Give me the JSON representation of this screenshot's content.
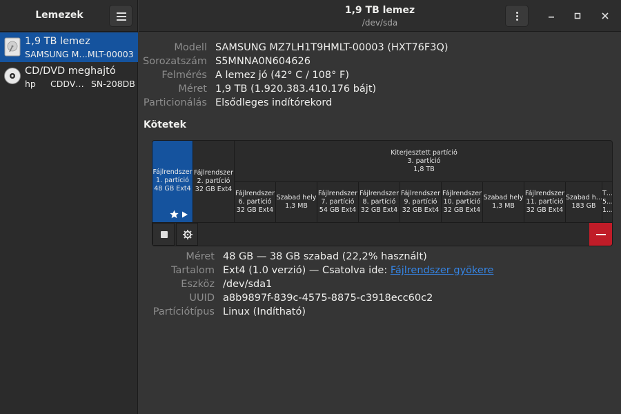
{
  "sidebar": {
    "title": "Lemezek",
    "menu_icon": "hamburger-menu-icon",
    "devices": [
      {
        "name": "1,9 TB lemez",
        "sub": "SAMSUNG M…MLT-00003",
        "icon": "disk-drive-icon",
        "selected": true
      },
      {
        "name": "CD/DVD meghajtó",
        "sub_a": "hp",
        "sub_b": "CDDV…",
        "sub_c": "SN-208DB",
        "icon": "optical-disc-icon",
        "selected": false
      }
    ]
  },
  "header": {
    "title": "1,9 TB lemez",
    "subtitle": "/dev/sda",
    "menu_icon": "kebab-menu-icon",
    "window_controls": [
      "minimize-icon",
      "maximize-icon",
      "close-icon"
    ]
  },
  "drive": {
    "rows": [
      {
        "key": "Modell",
        "value": "SAMSUNG MZ7LH1T9HMLT-00003 (HXT76F3Q)"
      },
      {
        "key": "Sorozatszám",
        "value": "S5MNNA0N604626"
      },
      {
        "key": "Felmérés",
        "value": "A lemez jó (42° C / 108° F)"
      },
      {
        "key": "Méret",
        "value": "1,9 TB (1.920.383.410.176 bájt)"
      },
      {
        "key": "Particionálás",
        "value": "Elsődleges indítórekord"
      }
    ]
  },
  "volumes": {
    "title": "Kötetek",
    "extended": {
      "l1": "Kiterjesztett partíció",
      "l2": "3. partíció",
      "l3": "1,8 TB"
    },
    "blocks": [
      {
        "l1": "Fájlrendszer",
        "l2": "1. partíció",
        "l3": "48 GB Ext4",
        "selected": true
      },
      {
        "l1": "Fájlrendszer",
        "l2": "2. partíció",
        "l3": "32 GB Ext4"
      },
      {
        "l1": "Fájlrendszer",
        "l2": "6. partíció",
        "l3": "32 GB Ext4"
      },
      {
        "l1": "Szabad hely",
        "l2": "1,3 MB",
        "l3": ""
      },
      {
        "l1": "Fájlrendszer",
        "l2": "7. partíció",
        "l3": "54 GB Ext4"
      },
      {
        "l1": "Fájlrendszer",
        "l2": "8. partíció",
        "l3": "32 GB Ext4"
      },
      {
        "l1": "Fájlrendszer",
        "l2": "9. partíció",
        "l3": "32 GB Ext4"
      },
      {
        "l1": "Fájlrendszer",
        "l2": "10. partíció",
        "l3": "32 GB Ext4"
      },
      {
        "l1": "Szabad hely",
        "l2": "1,3 MB",
        "l3": ""
      },
      {
        "l1": "Fájlrendszer",
        "l2": "11. partíció",
        "l3": "32 GB Ext4"
      },
      {
        "l1": "Szabad h…",
        "l2": "183 GB",
        "l3": ""
      },
      {
        "l1": "T…",
        "l2": "5…",
        "l3": "1…"
      }
    ],
    "toolbar_icons": [
      "stop-icon",
      "gear-icon",
      "minus-icon"
    ],
    "selected_badges": [
      "star-icon",
      "play-icon"
    ]
  },
  "partition": {
    "rows": [
      {
        "key": "Méret",
        "value": "48 GB — 38 GB szabad (22,2% használt)"
      },
      {
        "key": "Tartalom",
        "value": "Ext4 (1.0 verzió) — Csatolva ide: ",
        "link": "Fájlrendszer gyökere"
      },
      {
        "key": "Eszköz",
        "value": "/dev/sda1"
      },
      {
        "key": "UUID",
        "value": "a8b9897f-839c-4575-8875-c3918ecc60c2"
      },
      {
        "key": "Partíciótípus",
        "value": "Linux (Indítható)"
      }
    ]
  },
  "colors": {
    "accent": "#15539e",
    "danger": "#c01c28",
    "link": "#3584e4"
  }
}
